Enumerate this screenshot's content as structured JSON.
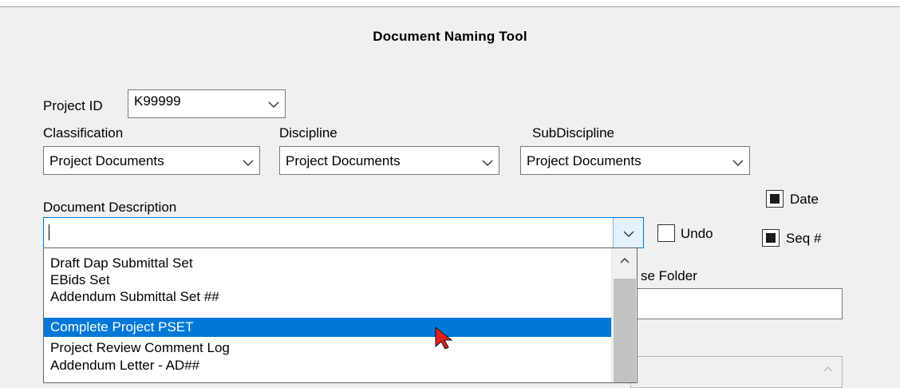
{
  "window": {
    "title": "Document Naming Tool"
  },
  "project_id": {
    "label": "Project ID",
    "value": "K99999"
  },
  "classification": {
    "label": "Classification",
    "value": "Project Documents"
  },
  "discipline": {
    "label": "Discipline",
    "value": "Project Documents"
  },
  "subdiscipline": {
    "label": "SubDiscipline",
    "value": "Project Documents"
  },
  "document_description": {
    "label": "Document Description",
    "value": ""
  },
  "options": {
    "undo": {
      "label": "Undo",
      "checked": false
    },
    "date": {
      "label": "Date",
      "checked": true
    },
    "seq": {
      "label": "Seq #",
      "checked": true
    }
  },
  "partial_label": "se Folder",
  "dropdown": {
    "items": [
      "Draft Dap Submittal Set",
      "EBids Set",
      "Addendum Submittal Set ##",
      "Complete Project PSET",
      "Project Review Comment Log",
      "Addendum Letter - AD##"
    ],
    "selected_index": 3
  },
  "colors": {
    "selection": "#0078d7",
    "focus_border": "#0078d7"
  },
  "icons": [
    "chevron-down-icon",
    "chevron-up-icon",
    "mouse-cursor-icon"
  ]
}
